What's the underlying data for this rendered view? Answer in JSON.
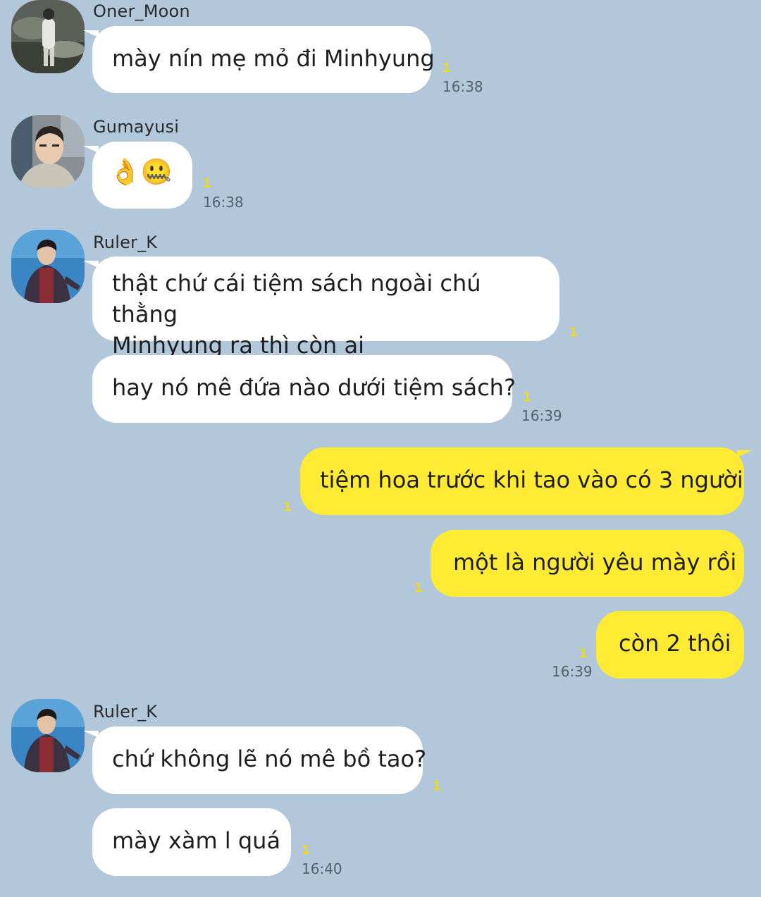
{
  "messages": [
    {
      "sender": "Oner_Moon",
      "text": "mày nín mẹ mỏ đi Minhyung",
      "unread": "1",
      "time": "16:38"
    },
    {
      "sender": "Gumayusi",
      "text": "👌🤐",
      "unread": "1",
      "time": "16:38"
    },
    {
      "sender": "Ruler_K",
      "text": "thật chứ cái tiệm sách ngoài chú thằng\nMinhyung ra thì còn ai",
      "unread": "1"
    },
    {
      "text": "hay nó mê đứa nào dưới tiệm sách?",
      "unread": "1",
      "time": "16:39"
    },
    {
      "text": "tiệm hoa trước khi tao vào có 3 người",
      "unread": "1"
    },
    {
      "text": "một là người yêu mày rồi",
      "unread": "1"
    },
    {
      "text": "còn 2 thôi",
      "unread": "1",
      "time": "16:39"
    },
    {
      "sender": "Ruler_K",
      "text": "chứ không lẽ nó mê bồ tao?",
      "unread": "1"
    },
    {
      "text": "mày xàm l quá",
      "unread": "1",
      "time": "16:40"
    }
  ],
  "colors": {
    "background": "#b2c7da",
    "incoming_bubble": "#ffffff",
    "outgoing_bubble": "#ffeb33",
    "unread_count": "#f5dc00",
    "timestamp": "#55606b"
  },
  "icons": [
    "avatar-oner",
    "avatar-gumayusi",
    "avatar-ruler"
  ]
}
